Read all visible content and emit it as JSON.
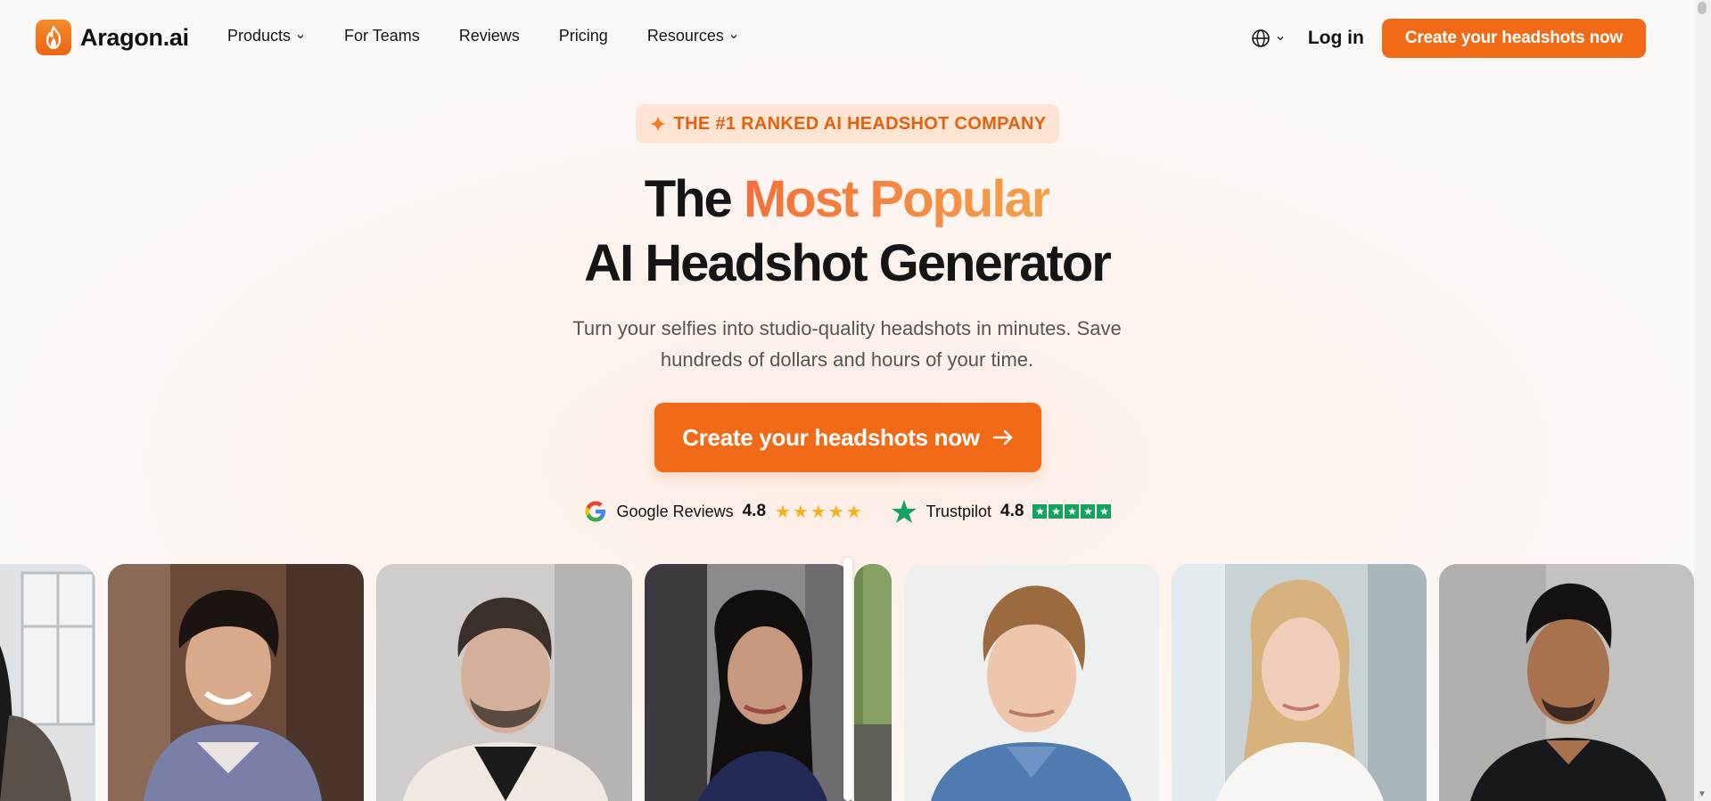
{
  "nav": {
    "logo_text": "Aragon.ai",
    "menu": [
      {
        "label": "Products",
        "has_dropdown": true
      },
      {
        "label": "For Teams",
        "has_dropdown": false
      },
      {
        "label": "Reviews",
        "has_dropdown": false
      },
      {
        "label": "Pricing",
        "has_dropdown": false
      },
      {
        "label": "Resources",
        "has_dropdown": true
      }
    ],
    "login_label": "Log in",
    "cta_label": "Create your headshots now"
  },
  "hero": {
    "badge": "THE #1 RANKED AI HEADSHOT COMPANY",
    "title_plain": "The",
    "title_accent": "Most Popular",
    "title_line2": "AI Headshot Generator",
    "subtitle": "Turn your selfies into studio-quality headshots in minutes. Save hundreds of dollars and hours of your time.",
    "cta_label": "Create your headshots now"
  },
  "ratings": {
    "google": {
      "label": "Google Reviews",
      "score": "4.8",
      "stars": 5
    },
    "trustpilot": {
      "label": "Trustpilot",
      "score": "4.8",
      "stars": 5
    }
  },
  "photos": [
    {
      "kind": "before",
      "subject": "woman-dark-hair-window"
    },
    {
      "kind": "before",
      "subject": "man-curly-hair-smiling"
    },
    {
      "kind": "before",
      "subject": "man-beard-selfie"
    },
    {
      "kind": "before",
      "subject": "woman-dark-hair-curtain"
    },
    {
      "kind": "after",
      "subject": "greenery-edge"
    },
    {
      "kind": "after",
      "subject": "young-man-blue-shirt"
    },
    {
      "kind": "after",
      "subject": "blonde-woman-white-blouse"
    },
    {
      "kind": "after",
      "subject": "man-black-shirt-concrete"
    }
  ],
  "colors": {
    "brand": "#f06a17",
    "accent_gradient_start": "#f46f3a",
    "accent_gradient_end": "#f5a04b",
    "trustpilot_green": "#14a261",
    "star_yellow": "#f6b01c"
  },
  "icons": [
    "flame-icon",
    "chevron-down-icon",
    "globe-icon",
    "sparkle-icon",
    "arrow-right-icon",
    "google-icon",
    "trustpilot-star-icon"
  ]
}
